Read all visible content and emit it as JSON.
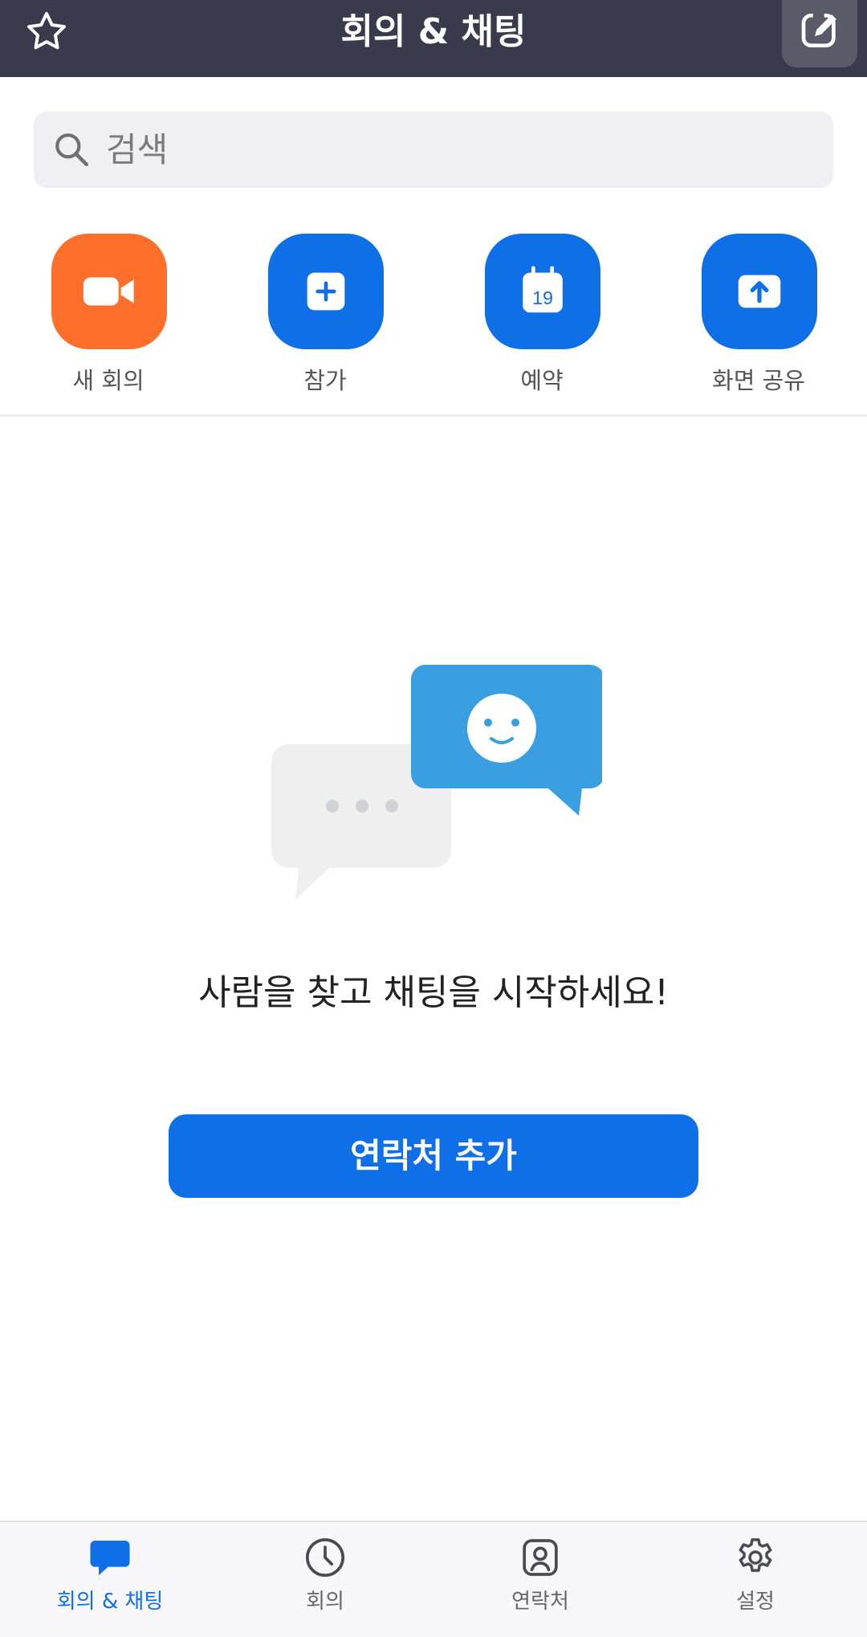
{
  "header": {
    "title": "회의 & 채팅",
    "star_icon": "star-icon",
    "edit_icon": "edit-icon"
  },
  "search": {
    "placeholder": "검색",
    "icon": "search-icon"
  },
  "actions": [
    {
      "label": "새 회의",
      "icon": "video-camera-icon",
      "color": "#ff6f2c"
    },
    {
      "label": "참가",
      "icon": "plus-icon",
      "color": "#0e6fe6"
    },
    {
      "label": "예약",
      "icon": "calendar-icon",
      "calendar_day": "19",
      "color": "#0e6fe6"
    },
    {
      "label": "화면 공유",
      "icon": "upload-arrow-icon",
      "color": "#0e6fe6"
    }
  ],
  "empty_state": {
    "illustration": "chat-bubbles-illustration",
    "message": "사람을 찾고 채팅을 시작하세요!",
    "button_label": "연락처 추가"
  },
  "tabbar": {
    "active_color": "#0e6fe6",
    "items": [
      {
        "label": "회의 & 채팅",
        "icon": "chat-bubble-icon",
        "active": true
      },
      {
        "label": "회의",
        "icon": "clock-icon",
        "active": false
      },
      {
        "label": "연락처",
        "icon": "contact-icon",
        "active": false
      },
      {
        "label": "설정",
        "icon": "gear-icon",
        "active": false
      }
    ]
  }
}
